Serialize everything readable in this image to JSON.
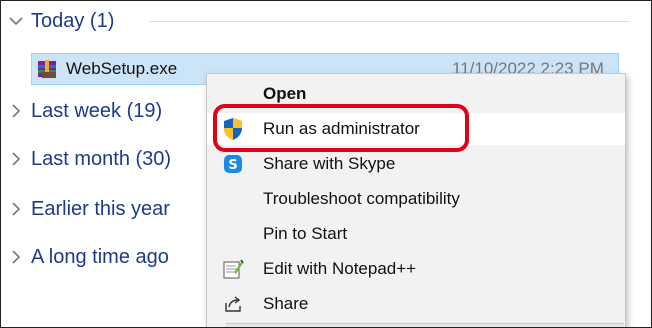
{
  "groups": [
    {
      "label": "Today (1)"
    },
    {
      "label": "Last week (19)"
    },
    {
      "label": "Last month (30)"
    },
    {
      "label": "Earlier this year"
    },
    {
      "label": "A long time ago"
    }
  ],
  "file": {
    "name": "WebSetup.exe",
    "date": "11/10/2022 2:23 PM"
  },
  "context_menu": {
    "items": [
      {
        "label": "Open",
        "icon": ""
      },
      {
        "label": "Run as administrator",
        "icon": "uac-shield-icon"
      },
      {
        "label": "Share with Skype",
        "icon": "skype-icon"
      },
      {
        "label": "Troubleshoot compatibility",
        "icon": ""
      },
      {
        "label": "Pin to Start",
        "icon": ""
      },
      {
        "label": "Edit with Notepad++",
        "icon": "notepadpp-icon"
      },
      {
        "label": "Share",
        "icon": "share-icon"
      }
    ]
  },
  "colors": {
    "group_text": "#1e3a8a",
    "selection_bg": "#cce4f7",
    "highlight": "#e0001a"
  }
}
